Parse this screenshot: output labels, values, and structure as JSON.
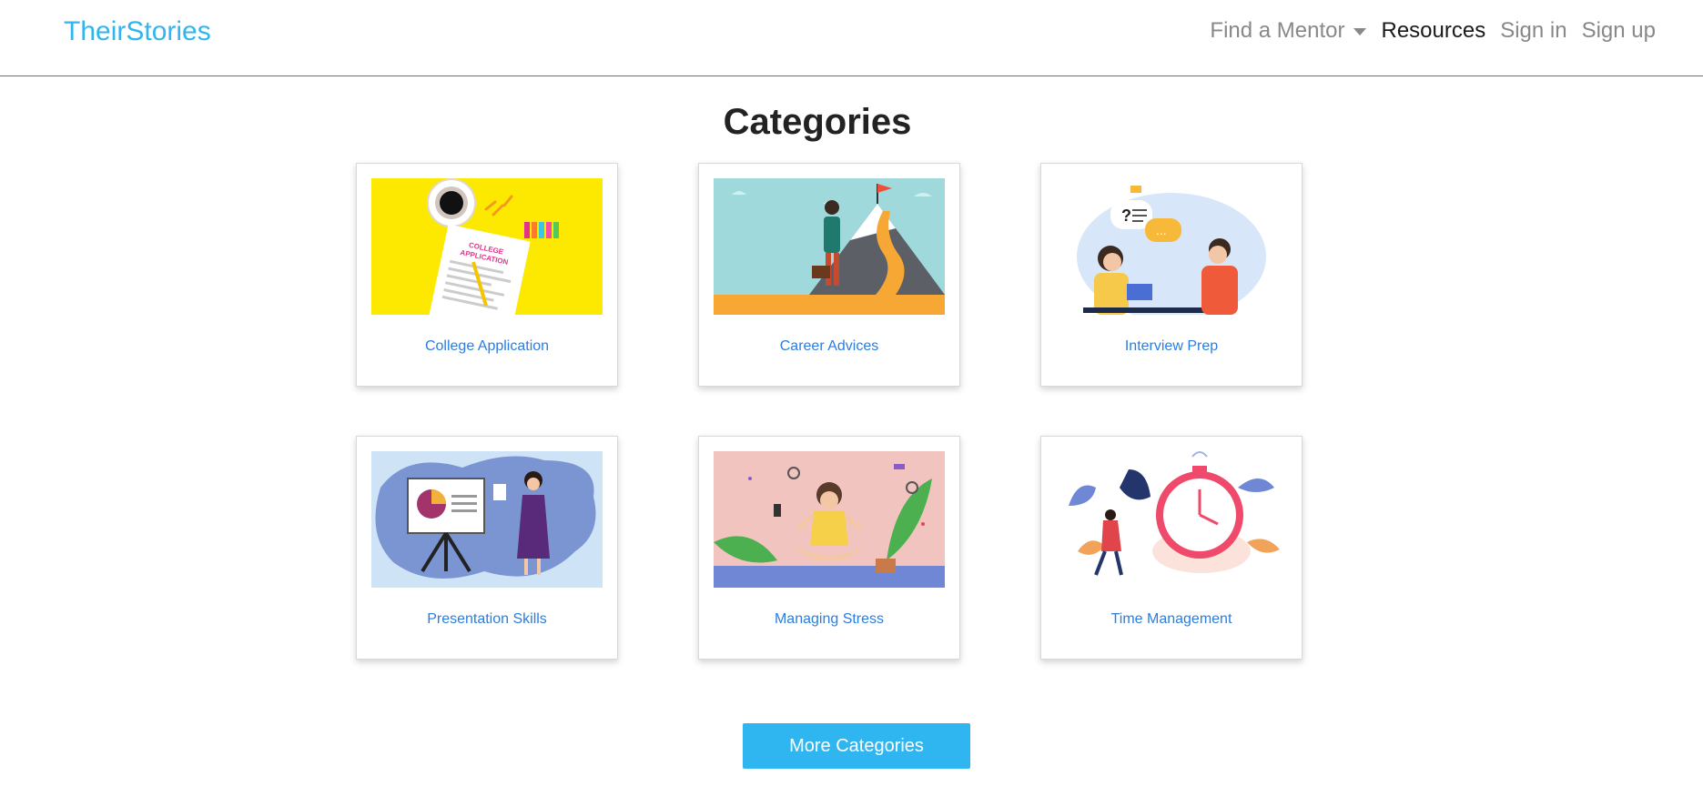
{
  "navbar": {
    "brand": "TheirStories",
    "find_mentor": "Find a Mentor",
    "resources": "Resources",
    "sign_in": "Sign in",
    "sign_up": "Sign up",
    "brand_color": "#2fb6f0"
  },
  "main": {
    "title": "Categories",
    "categories": [
      {
        "label": "College Application",
        "image": "college-application-illustration"
      },
      {
        "label": "Career Advices",
        "image": "career-mountain-illustration"
      },
      {
        "label": "Interview Prep",
        "image": "interview-conversation-illustration"
      },
      {
        "label": "Presentation Skills",
        "image": "presentation-easel-illustration"
      },
      {
        "label": "Managing Stress",
        "image": "meditation-illustration"
      },
      {
        "label": "Time Management",
        "image": "stopwatch-illustration"
      }
    ],
    "more_button": "More Categories",
    "link_color": "#2b7de0",
    "button_color": "#2fb6f0"
  }
}
